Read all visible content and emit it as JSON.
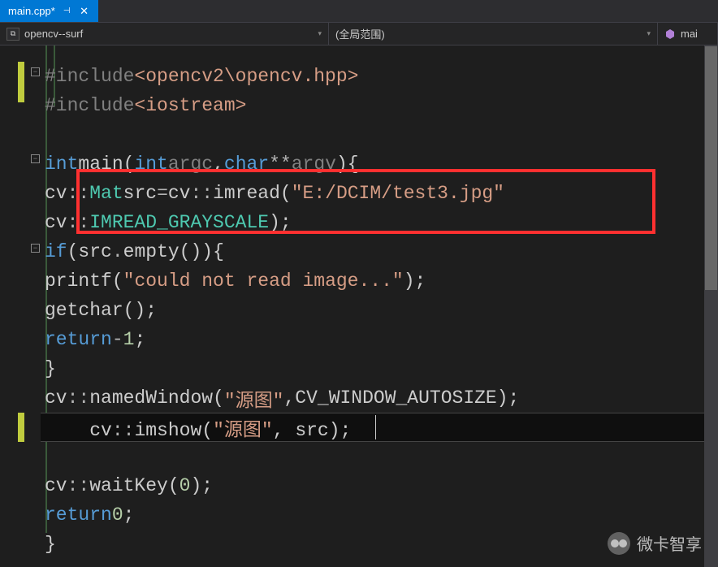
{
  "tab": {
    "filename": "main.cpp*"
  },
  "nav": {
    "project": "opencv--surf",
    "scope": "(全局范围)",
    "member": "mai"
  },
  "code": {
    "l1_include": "#include",
    "l1_path": "<opencv2\\opencv.hpp>",
    "l2_include": "#include",
    "l2_path": "<iostream>",
    "l4_int": "int",
    "l4_main": "main",
    "l4_int2": "int",
    "l4_argc": "argc",
    "l4_char": "char",
    "l4_argv": "argv",
    "l5_cv": "cv",
    "l5_mat": "Mat",
    "l5_src": "src",
    "l5_cv2": "cv",
    "l5_imread": "imread",
    "l5_str": "\"E:/DCIM/test3.jpg\"",
    "l6_cv": "cv",
    "l6_enum": "IMREAD_GRAYSCALE",
    "l7_if": "if",
    "l7_src": "src",
    "l7_empty": "empty",
    "l8_printf": "printf",
    "l8_str": "\"could not read image...\"",
    "l9_getchar": "getchar",
    "l10_return": "return",
    "l10_neg1": "1",
    "l12_cv": "cv",
    "l12_named": "namedWindow",
    "l12_str": "\"源图\"",
    "l12_flag": "CV_WINDOW_AUTOSIZE",
    "l13_cv": "cv",
    "l13_imshow": "imshow",
    "l13_str": "\"源图\"",
    "l13_src": "src",
    "l15_cv": "cv",
    "l15_waitkey": "waitKey",
    "l15_zero": "0",
    "l16_return": "return",
    "l16_zero": "0"
  },
  "watermark": "微卡智享"
}
